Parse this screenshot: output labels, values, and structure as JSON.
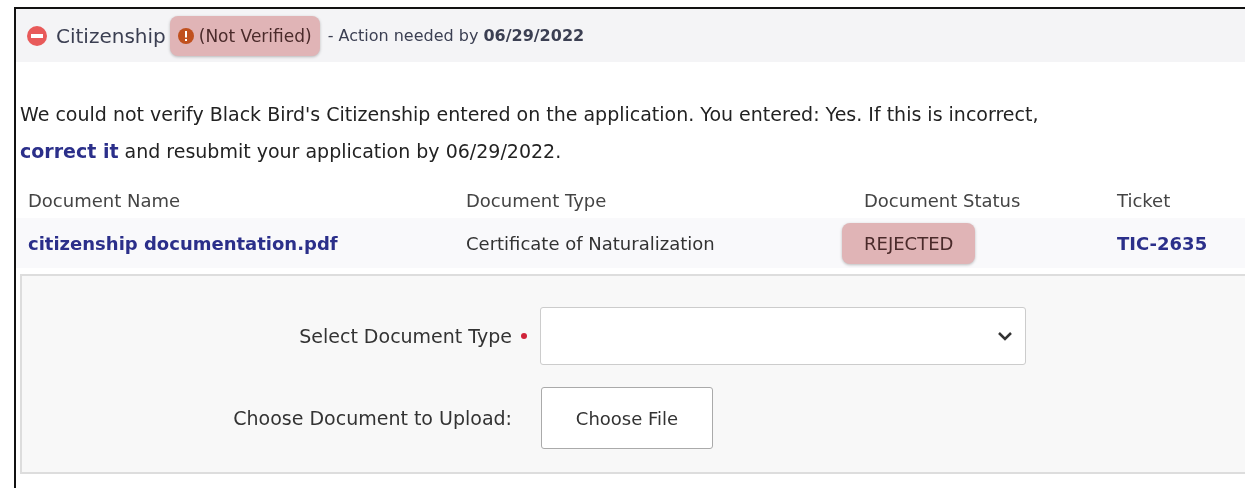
{
  "section": {
    "title": "Citizenship",
    "status": "(Not Verified)",
    "status_highlighted": true,
    "action_text": "- Action needed by",
    "action_date": "06/29/2022",
    "expanded": true
  },
  "message": {
    "text": "We could not verify Black Bird's Citizenship entered on the application. You entered: Yes. If this is incorrect,",
    "link": "correct it",
    "rest": "and resubmit your application by 06/29/2022."
  },
  "table": {
    "columns": [
      "Document Name",
      "Document Type",
      "Document Status",
      "Ticket"
    ],
    "rows": [
      {
        "name": "citizenship documentation.pdf",
        "type": "Certificate of Naturalization",
        "status": "REJECTED",
        "status_highlighted": true,
        "ticket": "TIC-2635"
      }
    ]
  },
  "form": {
    "fields": [
      {
        "kind": "select",
        "label": "Select Document Type",
        "required": true
      },
      {
        "kind": "file",
        "label": "Choose Document to Upload:",
        "required": false,
        "button": "Choose File"
      }
    ]
  }
}
